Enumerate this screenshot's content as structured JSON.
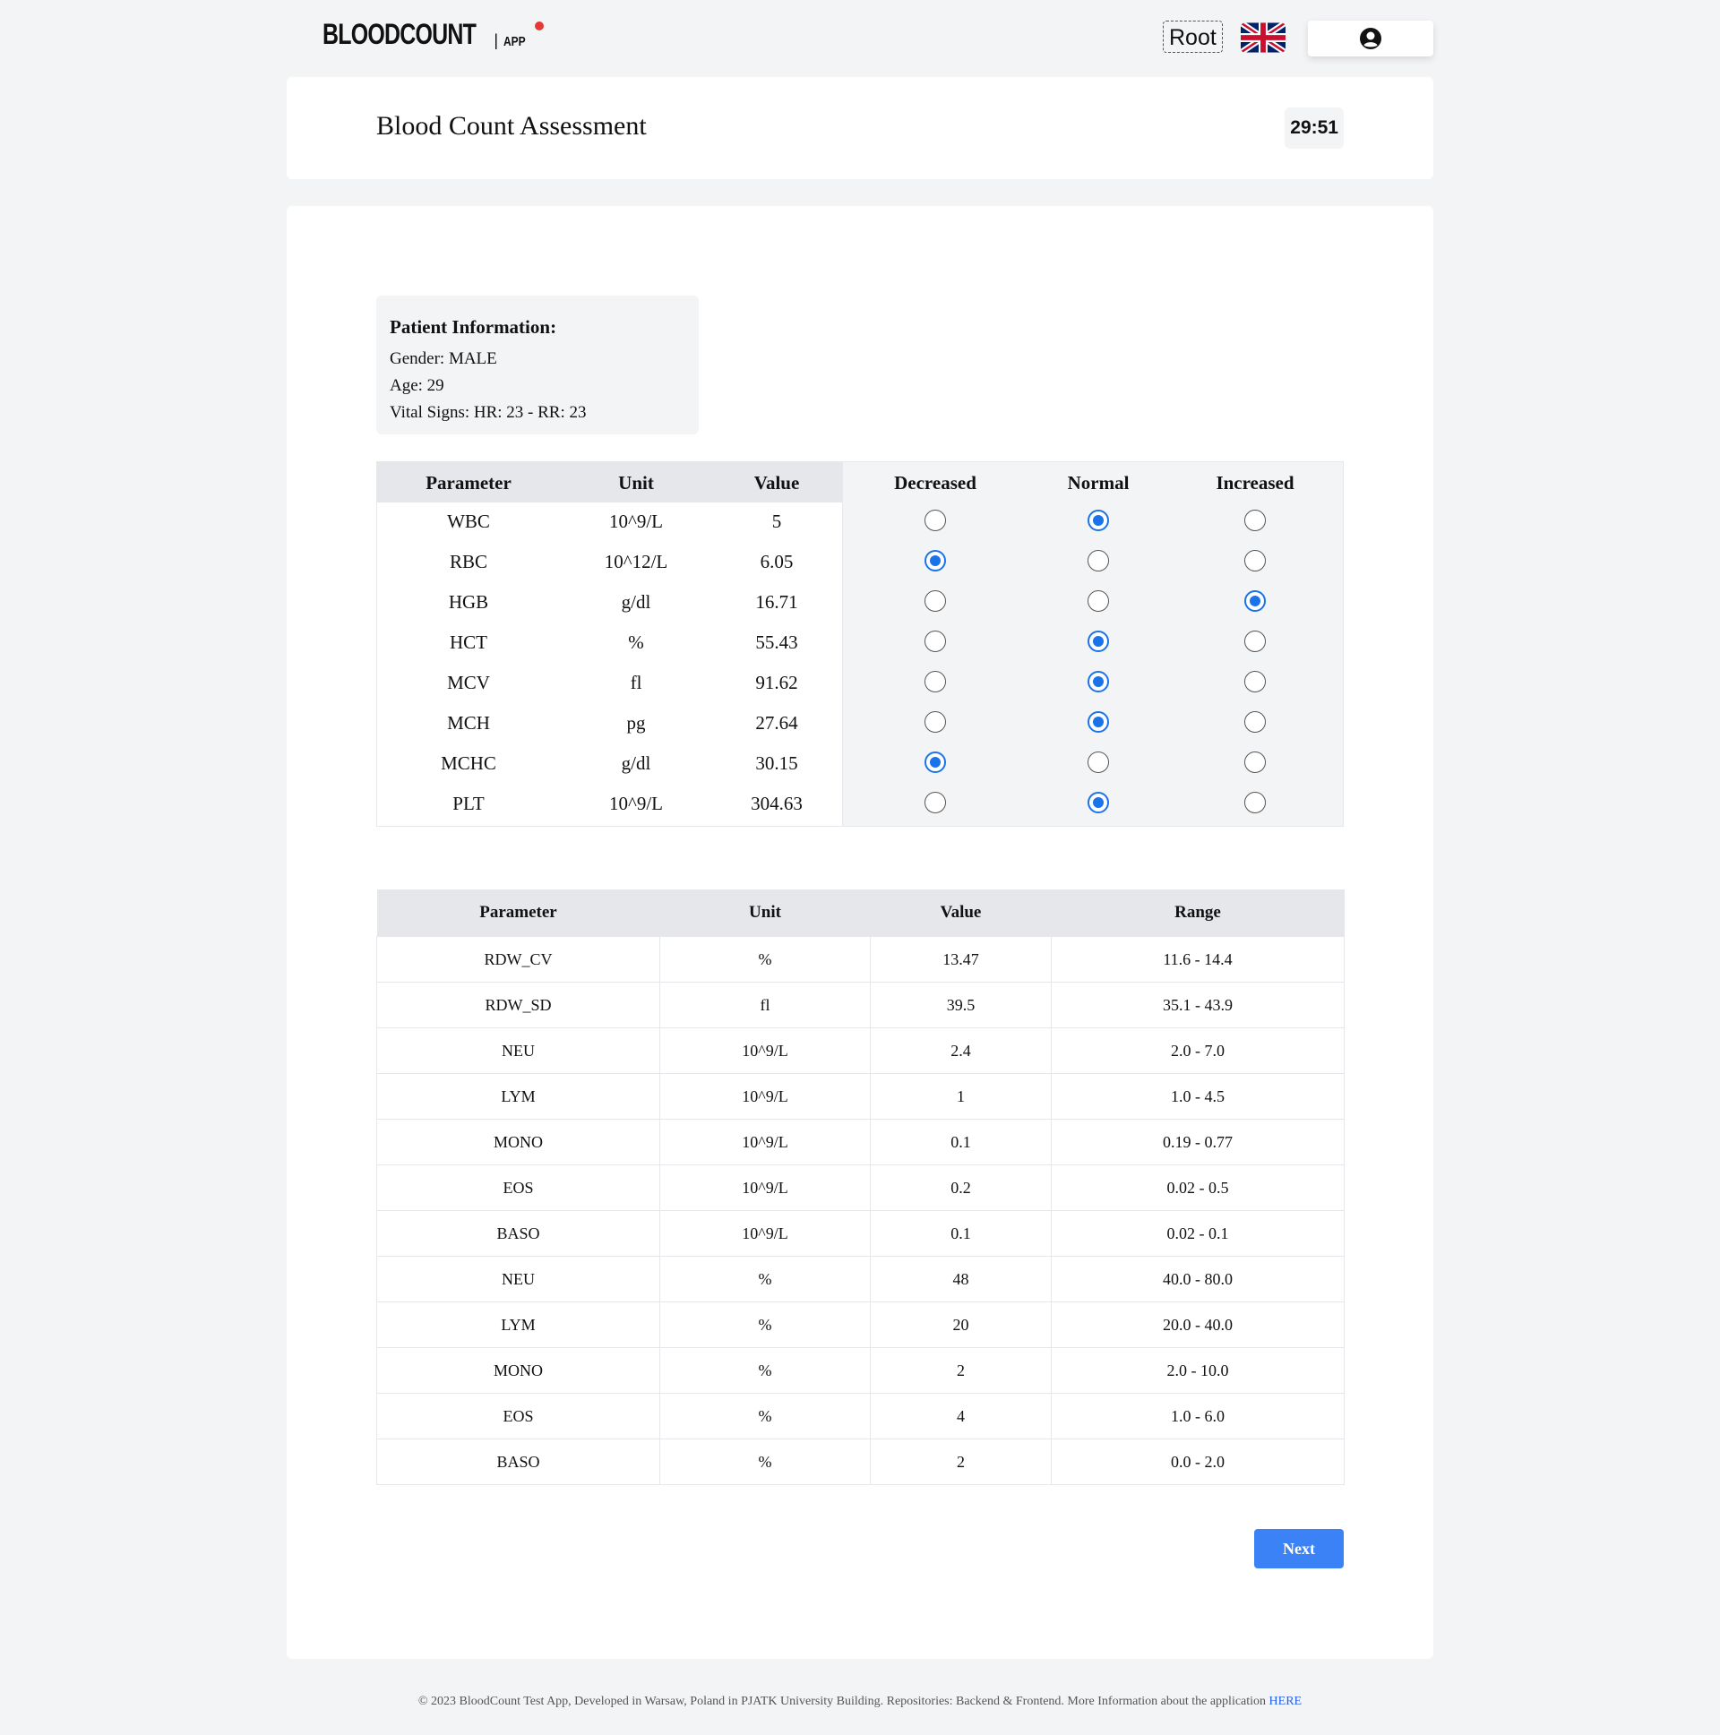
{
  "header": {
    "logo_main": "BLOODCOUNT",
    "logo_sep": "|",
    "logo_app": "APP",
    "role_label": "Root",
    "language_icon": "uk-flag-icon",
    "user_icon": "user-circle-icon"
  },
  "title_card": {
    "title": "Blood Count Assessment",
    "timer": "29:51"
  },
  "patient": {
    "heading": "Patient Information:",
    "gender": "Gender: MALE",
    "age": "Age: 29",
    "vitals": "Vital Signs: HR: 23 - RR: 23"
  },
  "assessment": {
    "headers": [
      "Parameter",
      "Unit",
      "Value",
      "Decreased",
      "Normal",
      "Increased"
    ],
    "rows": [
      {
        "parameter": "WBC",
        "unit": "10^9/L",
        "value": "5",
        "selected": "Normal"
      },
      {
        "parameter": "RBC",
        "unit": "10^12/L",
        "value": "6.05",
        "selected": "Decreased"
      },
      {
        "parameter": "HGB",
        "unit": "g/dl",
        "value": "16.71",
        "selected": "Increased"
      },
      {
        "parameter": "HCT",
        "unit": "%",
        "value": "55.43",
        "selected": "Normal"
      },
      {
        "parameter": "MCV",
        "unit": "fl",
        "value": "91.62",
        "selected": "Normal"
      },
      {
        "parameter": "MCH",
        "unit": "pg",
        "value": "27.64",
        "selected": "Normal"
      },
      {
        "parameter": "MCHC",
        "unit": "g/dl",
        "value": "30.15",
        "selected": "Decreased"
      },
      {
        "parameter": "PLT",
        "unit": "10^9/L",
        "value": "304.63",
        "selected": "Normal"
      }
    ]
  },
  "reference": {
    "headers": [
      "Parameter",
      "Unit",
      "Value",
      "Range"
    ],
    "rows": [
      {
        "parameter": "RDW_CV",
        "unit": "%",
        "value": "13.47",
        "range": "11.6 - 14.4"
      },
      {
        "parameter": "RDW_SD",
        "unit": "fl",
        "value": "39.5",
        "range": "35.1 - 43.9"
      },
      {
        "parameter": "NEU",
        "unit": "10^9/L",
        "value": "2.4",
        "range": "2.0 - 7.0"
      },
      {
        "parameter": "LYM",
        "unit": "10^9/L",
        "value": "1",
        "range": "1.0 - 4.5"
      },
      {
        "parameter": "MONO",
        "unit": "10^9/L",
        "value": "0.1",
        "range": "0.19 - 0.77"
      },
      {
        "parameter": "EOS",
        "unit": "10^9/L",
        "value": "0.2",
        "range": "0.02 - 0.5"
      },
      {
        "parameter": "BASO",
        "unit": "10^9/L",
        "value": "0.1",
        "range": "0.02 - 0.1"
      },
      {
        "parameter": "NEU",
        "unit": "%",
        "value": "48",
        "range": "40.0 - 80.0"
      },
      {
        "parameter": "LYM",
        "unit": "%",
        "value": "20",
        "range": "20.0 - 40.0"
      },
      {
        "parameter": "MONO",
        "unit": "%",
        "value": "2",
        "range": "2.0 - 10.0"
      },
      {
        "parameter": "EOS",
        "unit": "%",
        "value": "4",
        "range": "1.0 - 6.0"
      },
      {
        "parameter": "BASO",
        "unit": "%",
        "value": "2",
        "range": "0.0 - 2.0"
      }
    ]
  },
  "next_label": "Next",
  "footer": {
    "text": "© 2023 BloodCount Test App, Developed in Warsaw, Poland in PJATK University Building. Repositories: Backend & Frontend. More Information about the application ",
    "link": "HERE"
  },
  "colors": {
    "accent": "#3b82f6",
    "radio_selected": "#1a73e8",
    "logo_dot": "#e53935",
    "background": "#f3f4f6"
  }
}
